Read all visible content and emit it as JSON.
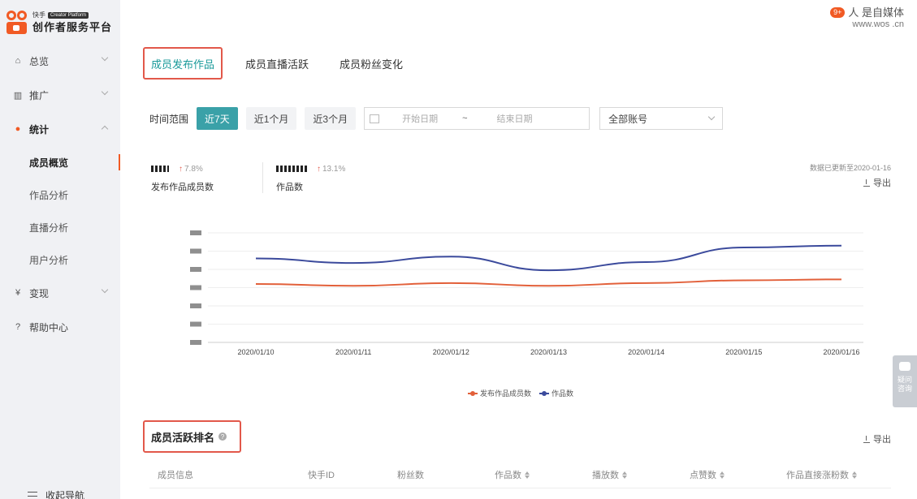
{
  "brand": {
    "top_small": "快手",
    "platform_tag": "Creator Platform",
    "name": "创作者服务平台"
  },
  "header": {
    "user_name": "人 是自媒体",
    "badge": "9+",
    "site": "www.wos .cn"
  },
  "sidebar": {
    "items": [
      {
        "label": "总览",
        "icon": "home-icon"
      },
      {
        "label": "推广",
        "icon": "bar-chart-icon"
      },
      {
        "label": "统计",
        "icon": "pie-chart-icon"
      },
      {
        "label": "变现",
        "icon": "yen-icon"
      },
      {
        "label": "帮助中心",
        "icon": "help-icon"
      }
    ],
    "sub_items": [
      "成员概览",
      "作品分析",
      "直播分析",
      "用户分析"
    ],
    "collapse_label": "收起导航"
  },
  "tabs": [
    "成员发布作品",
    "成员直播活跃",
    "成员粉丝变化"
  ],
  "filter": {
    "label": "时间范围",
    "options": [
      "近7天",
      "近1个月",
      "近3个月"
    ],
    "start_placeholder": "开始日期",
    "separator": "~",
    "end_placeholder": "结束日期",
    "account_select": "全部账号"
  },
  "stats": [
    {
      "change": "7.8%",
      "label": "发布作品成员数"
    },
    {
      "change": "13.1%",
      "label": "作品数"
    }
  ],
  "updated_note": "数据已更新至2020-01-16",
  "export_label": "导出",
  "chart_data": {
    "type": "line",
    "x": [
      "2020/01/10",
      "2020/01/11",
      "2020/01/12",
      "2020/01/13",
      "2020/01/14",
      "2020/01/15",
      "2020/01/16"
    ],
    "ylim": [
      0,
      6
    ],
    "y_tick_count": 7,
    "grid": true,
    "legend_position": "bottom-center",
    "series": [
      {
        "name": "发布作品成员数",
        "color": "#e2603a",
        "values": [
          3.2,
          3.1,
          3.25,
          3.1,
          3.25,
          3.4,
          3.45
        ]
      },
      {
        "name": "作品数",
        "color": "#3b4a9c",
        "values": [
          4.6,
          4.35,
          4.7,
          3.95,
          4.4,
          5.2,
          5.3
        ]
      }
    ]
  },
  "ranking": {
    "title": "成员活跃排名",
    "help_icon": "question-icon",
    "export_label": "导出",
    "columns": [
      {
        "label": "成员信息",
        "sortable": false
      },
      {
        "label": "快手ID",
        "sortable": false
      },
      {
        "label": "粉丝数",
        "sortable": false
      },
      {
        "label": "作品数",
        "sortable": true
      },
      {
        "label": "播放数",
        "sortable": true
      },
      {
        "label": "点赞数",
        "sortable": true
      },
      {
        "label": "作品直接涨粉数",
        "sortable": true
      }
    ]
  },
  "float_help": {
    "line1": "疑问",
    "line2": "咨询"
  }
}
